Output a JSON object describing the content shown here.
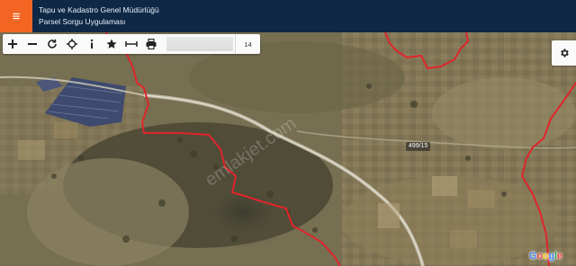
{
  "header": {
    "menu_icon": "hamburger-icon",
    "title_line1": "Tapu ve Kadastro Genel Müdürlüğü",
    "title_line2": "Parsel Sorgu Uygulaması",
    "background": "#0f2846",
    "accent": "#f26522"
  },
  "toolbar": {
    "tools": [
      "zoom-in-icon",
      "zoom-out-icon",
      "refresh-icon",
      "locate-icon",
      "info-icon",
      "favorite-star-icon",
      "measure-icon",
      "print-icon"
    ],
    "search_value": "",
    "zoom_level": "14"
  },
  "map": {
    "parcel_label": "499/15",
    "boundary_color": "#e0252b",
    "watermark": "emlakjet.com",
    "attribution": [
      "G",
      "o",
      "o",
      "g",
      "l",
      "e"
    ]
  },
  "settings": {
    "icon": "gear-icon"
  }
}
